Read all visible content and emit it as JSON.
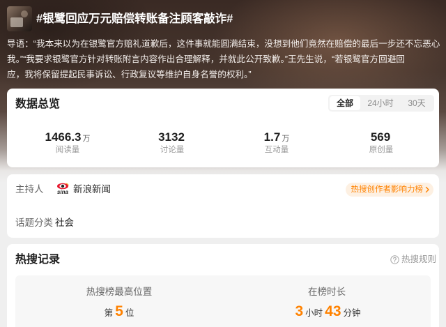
{
  "colors": {
    "accent": "#ff8200",
    "accent_bg": "#fdf0e2",
    "text_primary": "#1f1f1f",
    "text_secondary": "#999999",
    "card_bg": "#ffffff",
    "page_bg": "#efefef",
    "header_bg": "#3a2a24"
  },
  "header": {
    "thumbnail_icon": "topic-thumbnail-image",
    "title": "#银鹭回应万元赔偿转账备注顾客敲诈#",
    "intro_lines": [
      "导语：“我本来以为在银鹭官方赔礼道歉后，这件事就能圆满结束，没想到他们竟然在赔偿的最后一步还不忘恶心",
      "我。”“我要求银鹭官方针对转账附言内容作出合理解释，并就此公开致歉。”王先生说，“若银鹭官方回避回",
      "应，我将保留提起民事诉讼、行政复议等维护自身名誉的权利。”"
    ]
  },
  "overview": {
    "title": "数据总览",
    "tabs": [
      {
        "label": "全部",
        "selected": true
      },
      {
        "label": "24小时",
        "selected": false
      },
      {
        "label": "30天",
        "selected": false
      }
    ],
    "stats": [
      {
        "value": "1466.3",
        "unit": "万",
        "label": "阅读量"
      },
      {
        "value": "3132",
        "unit": "",
        "label": "讨论量"
      },
      {
        "value": "1.7",
        "unit": "万",
        "label": "互动量"
      },
      {
        "value": "569",
        "unit": "",
        "label": "原创量"
      }
    ]
  },
  "info": {
    "host_label": "主持人",
    "host_logo_icon": "sina-logo-icon",
    "host_logo_text": "sina",
    "host_name": "新浪新闻",
    "rank_pill_label": "热搜创作者影响力榜",
    "rank_pill_icon": "chevron-right-icon",
    "category_label": "话题分类",
    "category_value": "社会"
  },
  "record": {
    "title": "热搜记录",
    "rules_icon": "question-circle-icon",
    "rules_label": "热搜规则",
    "peak": {
      "label": "热搜榜最高位置",
      "prefix": "第",
      "value": "5",
      "suffix": "位"
    },
    "duration": {
      "label": "在榜时长",
      "hours": "3",
      "hours_unit": "小时",
      "minutes": "43",
      "minutes_unit": "分钟"
    }
  }
}
